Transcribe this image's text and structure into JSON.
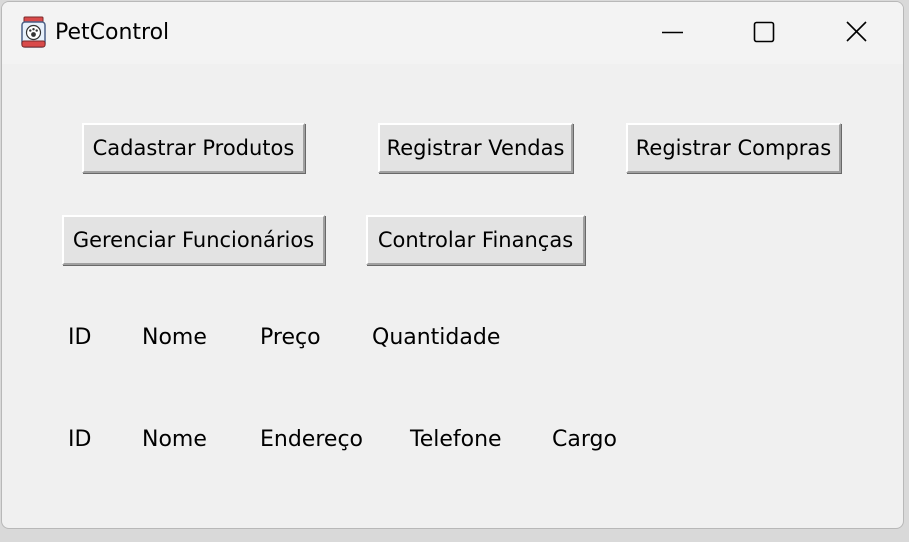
{
  "window": {
    "title": "PetControl",
    "app_icon": "paw-jar-icon",
    "controls": {
      "minimize_icon": "minimize-icon",
      "maximize_icon": "maximize-icon",
      "close_icon": "close-icon"
    }
  },
  "buttons": {
    "cadastrar_produtos": "Cadastrar Produtos",
    "registrar_vendas": "Registrar Vendas",
    "registrar_compras": "Registrar Compras",
    "gerenciar_funcionarios": "Gerenciar Funcionários",
    "controlar_financas": "Controlar Finanças"
  },
  "produtos_header": {
    "columns": [
      "ID",
      "Nome",
      "Preço",
      "Quantidade"
    ]
  },
  "funcionarios_header": {
    "columns": [
      "ID",
      "Nome",
      "Endereço",
      "Telefone",
      "Cargo"
    ]
  },
  "colors": {
    "window_bg": "#f0f0f0",
    "titlebar_bg": "#f3f3f3",
    "button_bg": "#e3e3e3"
  }
}
